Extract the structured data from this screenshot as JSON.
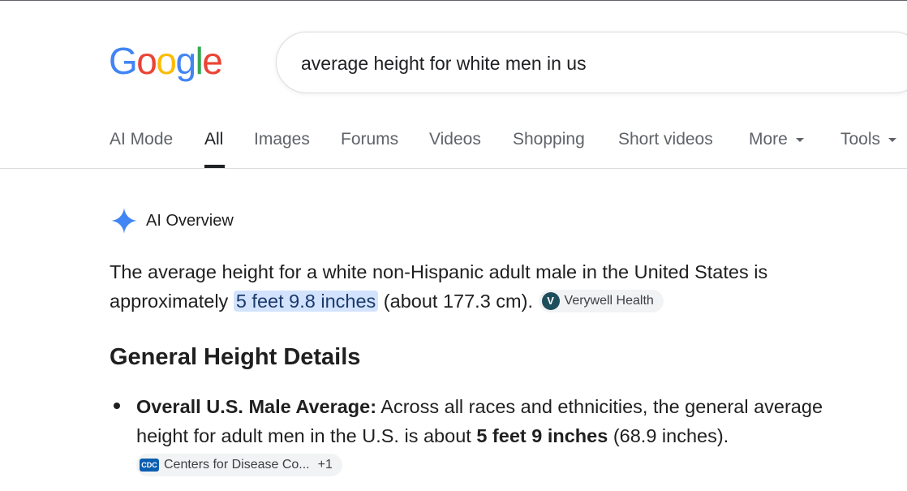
{
  "logo": {
    "letters": [
      "G",
      "o",
      "o",
      "g",
      "l",
      "e"
    ],
    "colors": [
      "#4285F4",
      "#EA4335",
      "#FBBC05",
      "#4285F4",
      "#34A853",
      "#EA4335"
    ]
  },
  "search": {
    "query": "average height for white men in us"
  },
  "tabs": [
    {
      "label": "AI Mode"
    },
    {
      "label": "All",
      "active": true
    },
    {
      "label": "Images"
    },
    {
      "label": "Forums"
    },
    {
      "label": "Videos"
    },
    {
      "label": "Shopping"
    },
    {
      "label": "Short videos"
    },
    {
      "label": "More"
    },
    {
      "label": "Tools"
    }
  ],
  "ai_overview": {
    "title": "AI Overview",
    "para_part1": "The average height for a white non-Hispanic adult male in the United States is approximately ",
    "para_highlight": "5 feet 9.8 inches",
    "para_part2": " (about 177.3 cm).",
    "source1": {
      "icon_letter": "V",
      "label": "Verywell Health"
    },
    "section_heading": "General Height Details",
    "bullet1": {
      "bold_lead": "Overall U.S. Male Average:",
      "text1": " Across all races and ethnicities, the general average height for adult men in the U.S. is about ",
      "bold_value": "5 feet 9 inches",
      "text2": " (68.9 inches).",
      "source": {
        "icon_text": "CDC",
        "label": "Centers for Disease Co...",
        "extra": "+1"
      }
    }
  },
  "colors": {
    "highlight_bg": "#d3e3fd",
    "ai_icon": "#4285F4"
  }
}
